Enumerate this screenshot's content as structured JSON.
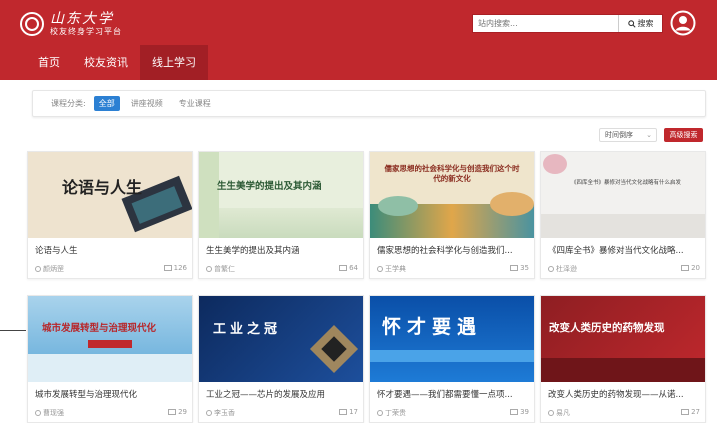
{
  "header": {
    "logo_main": "山东大学",
    "logo_sub": "校友终身学习平台",
    "search_placeholder": "站内搜索...",
    "search_button": "搜索"
  },
  "nav": {
    "items": [
      {
        "label": "首页",
        "active": false
      },
      {
        "label": "校友资讯",
        "active": false
      },
      {
        "label": "线上学习",
        "active": true
      }
    ]
  },
  "filter": {
    "label": "课程分类:",
    "options": [
      {
        "label": "全部",
        "active": true
      },
      {
        "label": "讲座视频",
        "active": false
      },
      {
        "label": "专业课程",
        "active": false
      }
    ]
  },
  "sort": {
    "selected": "时间倒序",
    "advanced_button": "高级搜索"
  },
  "courses": [
    {
      "title": "论语与人生",
      "author": "颜炳罡",
      "views": "126",
      "cover_text": "论语与人生"
    },
    {
      "title": "生生美学的提出及其内涵",
      "author": "曾繁仁",
      "views": "64",
      "cover_text": "生生美学的提出及其内涵"
    },
    {
      "title": "儒家思想的社会科学化与创造我们...",
      "author": "王学典",
      "views": "35",
      "cover_text": "儒家思想的社会科学化与创造我们这个时代的新文化"
    },
    {
      "title": "《四库全书》暴修对当代文化战略...",
      "author": "杜泽逊",
      "views": "20",
      "cover_text": "《四库全书》暴修对当代文化战略有什么启发"
    },
    {
      "title": "城市发展转型与治理现代化",
      "author": "曹现强",
      "views": "29",
      "cover_text": "城市发展转型与治理现代化"
    },
    {
      "title": "工业之冠——芯片的发展及应用",
      "author": "李玉香",
      "views": "17",
      "cover_text": "工业之冠"
    },
    {
      "title": "怀才要遇——我们都需要懂一点项...",
      "author": "丁荣贵",
      "views": "39",
      "cover_text": "怀才要遇"
    },
    {
      "title": "改变人类历史的药物发现——从诺...",
      "author": "易凡",
      "views": "27",
      "cover_text": "改变人类历史的药物发现"
    }
  ],
  "colors": {
    "brand_red": "#c0282d",
    "nav_active": "#a21f25",
    "chip_blue": "#2c80d3"
  }
}
